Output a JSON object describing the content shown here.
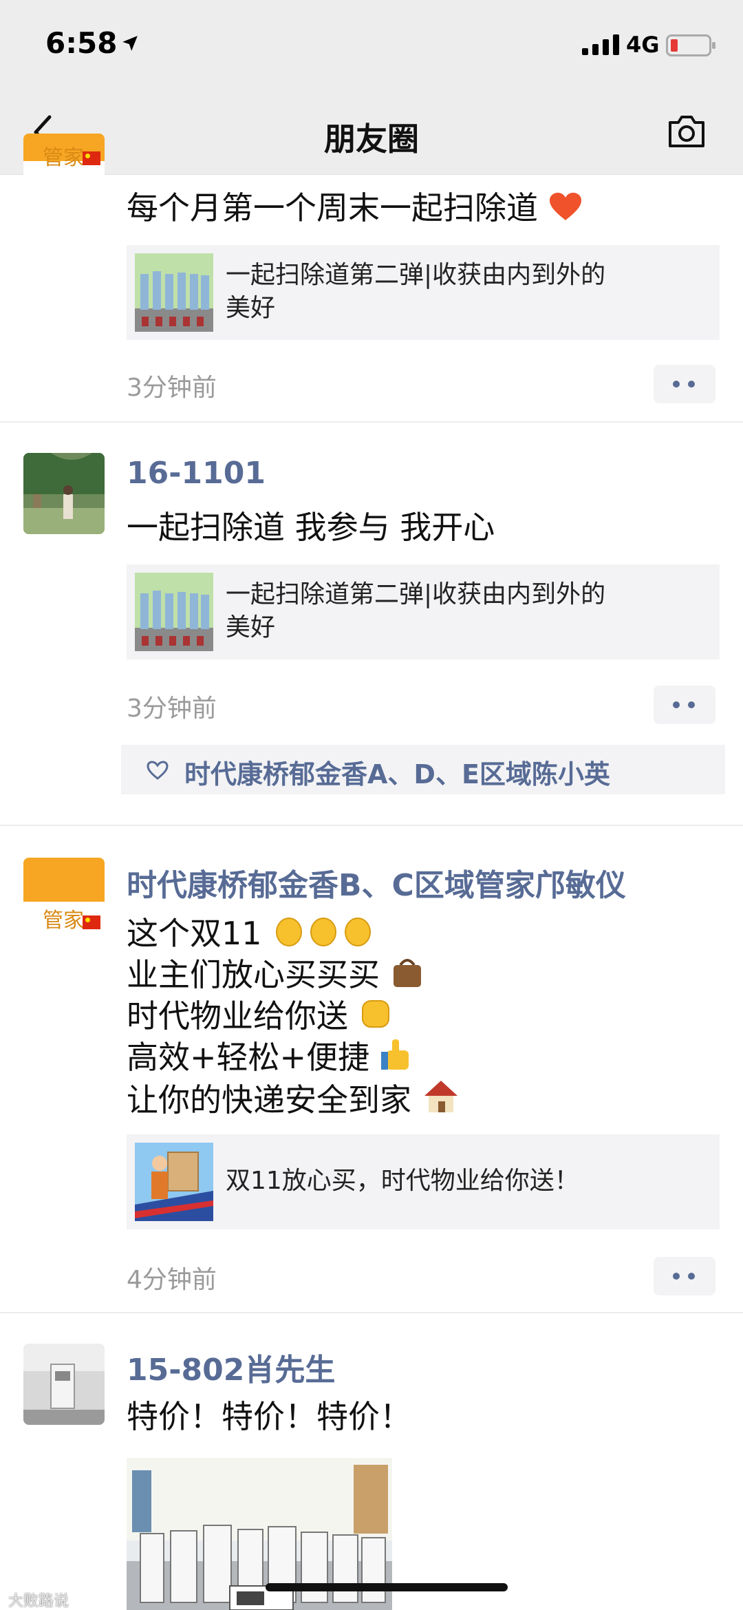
{
  "status": {
    "time": "6:58",
    "network": "4G"
  },
  "nav": {
    "title": "朋友圈"
  },
  "posts": [
    {
      "text": "每个月第一个周末一起扫除道",
      "link": {
        "line1": "一起扫除道第二弹|收获由内到外的",
        "line2": "美好"
      },
      "time": "3分钟前",
      "avatar_text": "管家"
    },
    {
      "name": "16-1101",
      "text": "一起扫除道 我参与 我开心",
      "link": {
        "line1": "一起扫除道第二弹|收获由内到外的",
        "line2": "美好"
      },
      "time": "3分钟前",
      "likes": "时代康桥郁金香A、D、E区域陈小英"
    },
    {
      "name": "时代康桥郁金香B、C区域管家邝敏仪",
      "lines": [
        "这个双11",
        "业主们放心买买买",
        "时代物业给你送",
        "高效+轻松+便捷",
        "让你的快递安全到家"
      ],
      "link": {
        "line1": "双11放心买，时代物业给你送！"
      },
      "time": "4分钟前",
      "avatar_text": "管家"
    },
    {
      "name": "15-802肖先生",
      "text": "特价！特价！特价！"
    }
  ],
  "watermark": "大败路说"
}
